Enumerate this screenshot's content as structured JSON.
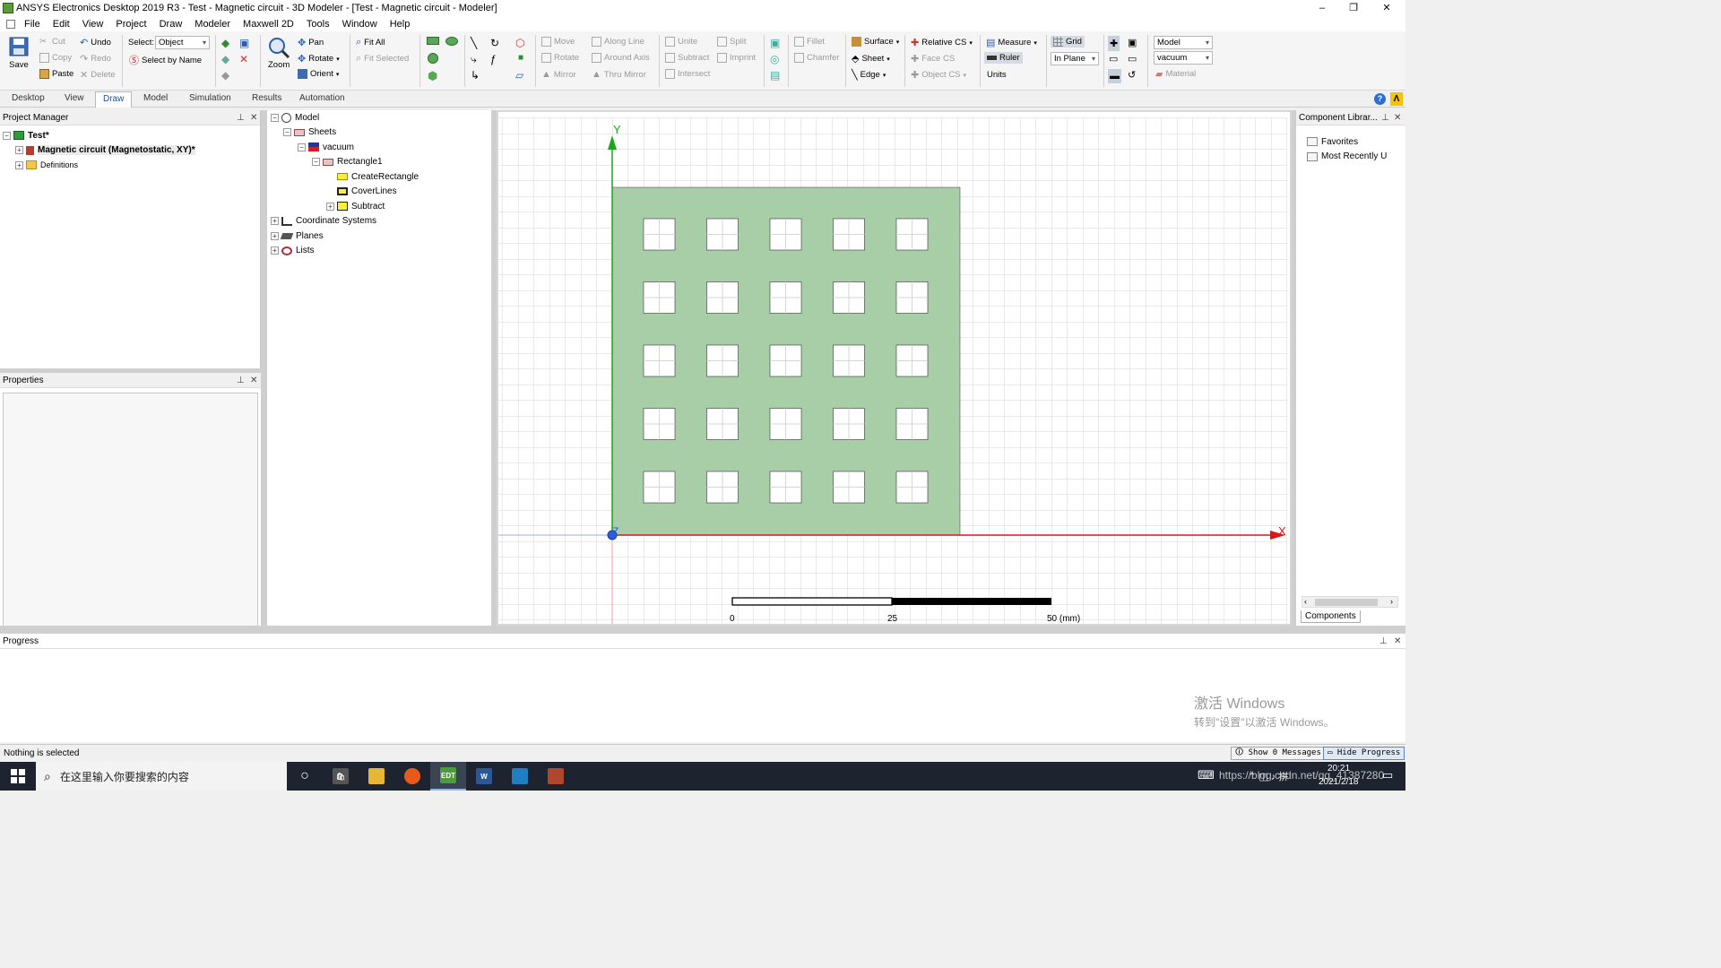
{
  "window": {
    "title": "ANSYS Electronics Desktop 2019 R3 - Test - Magnetic circuit - 3D Modeler - [Test - Magnetic circuit - Modeler]",
    "minimize": "–",
    "maximize": "❐",
    "close": "✕"
  },
  "menu": [
    "File",
    "Edit",
    "View",
    "Project",
    "Draw",
    "Modeler",
    "Maxwell 2D",
    "Tools",
    "Window",
    "Help"
  ],
  "ribbon": {
    "save": "Save",
    "cut": "Cut",
    "copy": "Copy",
    "paste": "Paste",
    "undo": "Undo",
    "redo": "Redo",
    "delete": "Delete",
    "select_label": "Select:",
    "select_value": "Object",
    "select_by_name": "Select by Name",
    "zoom": "Zoom",
    "pan": "Pan",
    "rotate": "Rotate",
    "orient": "Orient",
    "fit_all": "Fit All",
    "fit_selected": "Fit Selected",
    "move": "Move",
    "rotate2": "Rotate",
    "mirror": "Mirror",
    "along_line": "Along Line",
    "around_axis": "Around Axis",
    "thru_mirror": "Thru Mirror",
    "unite": "Unite",
    "subtract": "Subtract",
    "intersect": "Intersect",
    "split": "Split",
    "imprint": "Imprint",
    "fillet": "Fillet",
    "chamfer": "Chamfer",
    "surface": "Surface",
    "sheet": "Sheet",
    "edge": "Edge",
    "relative_cs": "Relative CS",
    "face_cs": "Face CS",
    "object_cs": "Object CS",
    "measure": "Measure",
    "ruler": "Ruler",
    "units": "Units",
    "grid": "Grid",
    "in_plane": "In Plane",
    "model_combo": "Model",
    "material_combo": "vacuum",
    "material": "Material"
  },
  "tabs": [
    "Desktop",
    "View",
    "Draw",
    "Model",
    "Simulation",
    "Results",
    "Automation"
  ],
  "active_tab": "Draw",
  "project_manager": {
    "title": "Project Manager",
    "project": "Test*",
    "design": "Magnetic circuit (Magnetostatic, XY)*",
    "definitions": "Definitions"
  },
  "properties": {
    "title": "Properties"
  },
  "model_tree": {
    "model": "Model",
    "sheets": "Sheets",
    "material": "vacuum",
    "object": "Rectangle1",
    "ops": [
      "CreateRectangle",
      "CoverLines",
      "Subtract"
    ],
    "coord": "Coordinate Systems",
    "planes": "Planes",
    "lists": "Lists"
  },
  "viewport": {
    "x_axis": "X",
    "y_axis": "Y",
    "z_axis": "Z",
    "scale": {
      "left": "0",
      "mid": "25",
      "right": "50 (mm)"
    },
    "sheet_color": "#a7cea6",
    "hole_grid": {
      "rows": 5,
      "cols": 5
    }
  },
  "component_library": {
    "title": "Component Librar...",
    "favorites": "Favorites",
    "recent": "Most Recently U",
    "tab": "Components"
  },
  "progress": {
    "title": "Progress",
    "watermark_line1": "激活 Windows",
    "watermark_line2": "转到\"设置\"以激活 Windows。"
  },
  "status": {
    "text": "Nothing is selected",
    "show_messages": "Show 0 Messages",
    "hide_progress": "Hide Progress"
  },
  "taskbar": {
    "search_placeholder": "在这里输入你要搜索的内容",
    "time": "20:21",
    "date": "2021/2/18",
    "url_overlay": "https://blog.csdn.net/qq_41387280",
    "edt": "EDT",
    "word": "W"
  }
}
